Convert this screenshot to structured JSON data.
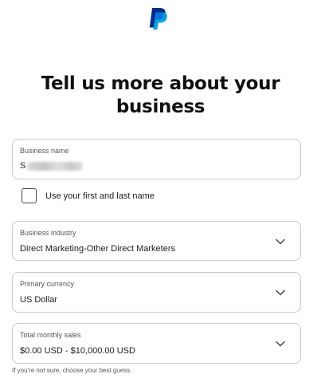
{
  "brand": {
    "logo_icon": "paypal-logo-icon",
    "colors": {
      "dark_blue": "#002c8a",
      "light_blue": "#009cde",
      "mid_blue": "#0070e0"
    }
  },
  "headline": {
    "line1": "Tell us more about your",
    "line2": "business"
  },
  "business_name": {
    "label": "Business name",
    "value_visible_prefix": "S"
  },
  "use_name_checkbox": {
    "label": "Use your first and last name",
    "checked": false
  },
  "business_industry": {
    "label": "Business industry",
    "value": "Direct Marketing-Other Direct Marketers",
    "icon": "chevron-down-icon"
  },
  "primary_currency": {
    "label": "Primary currency",
    "value": "US Dollar",
    "icon": "chevron-down-icon"
  },
  "total_monthly_sales": {
    "label": "Total monthly sales",
    "value": "$0.00 USD - $10,000.00 USD",
    "icon": "chevron-down-icon"
  },
  "hint": "If you're not sure, choose your best guess."
}
